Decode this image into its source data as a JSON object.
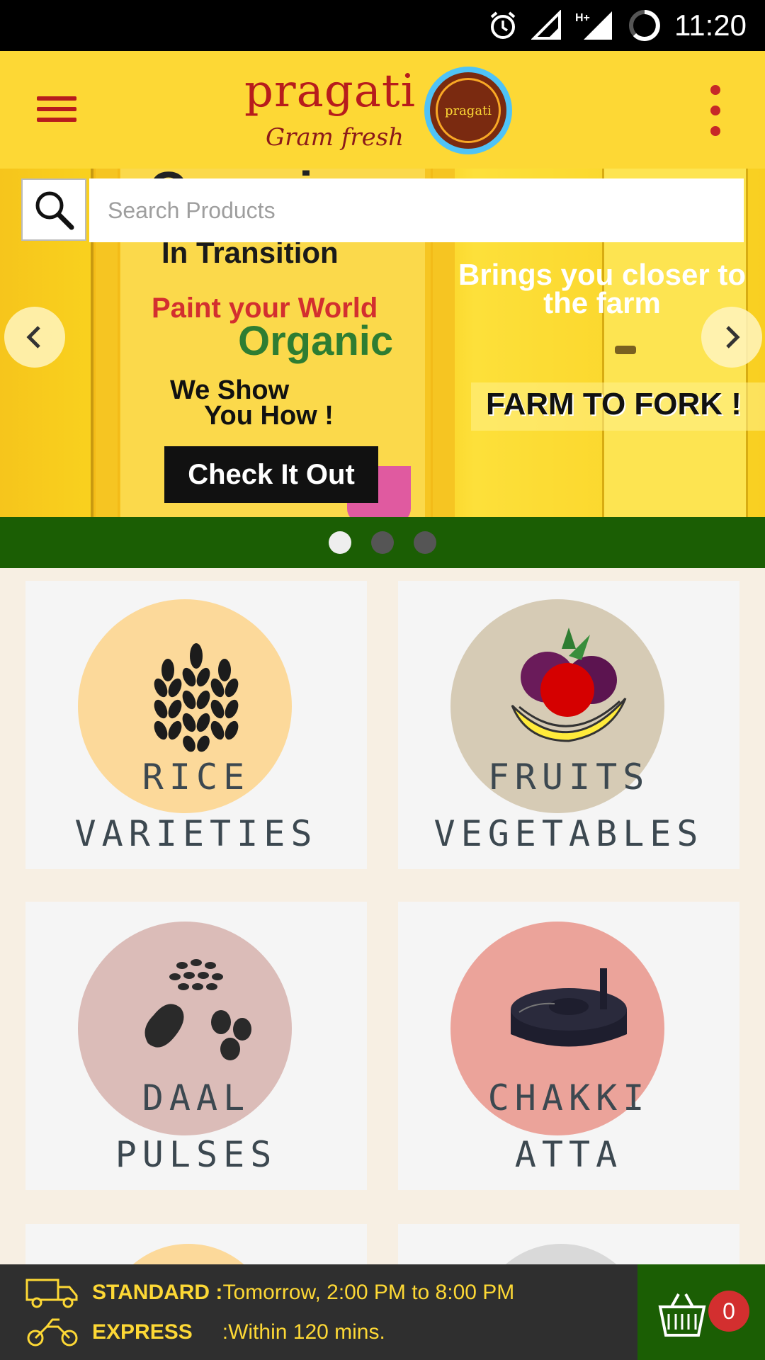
{
  "status_bar": {
    "time": "11:20",
    "icons": [
      "alarm-icon",
      "signal-roaming-icon",
      "signal-hplus-icon",
      "battery-icon"
    ]
  },
  "app_bar": {
    "logo_title": "pragati",
    "logo_subtitle": "Gram fresh",
    "logo_seal_text": "pragati",
    "brand_color": "#fdd835",
    "accent_color": "#b71c1c"
  },
  "search": {
    "placeholder": "Search Products"
  },
  "banner": {
    "heading": "Organic",
    "line_in_transition": "In Transition",
    "line_paint": "Paint your World",
    "line_organic": "Organic",
    "line_we_show": "We Show",
    "line_you_how": "You How !",
    "cta": "Check It Out",
    "tagline": "Brings you closer to the farm",
    "slogan": "FARM TO FORK !",
    "slides_count": 3,
    "active_slide": 1
  },
  "categories": [
    {
      "top": "RICE",
      "bottom": "VARIETIES",
      "circle_color": "#fcd99a",
      "icon": "wheat-icon"
    },
    {
      "top": "FRUITS",
      "bottom": "VEGETABLES",
      "circle_color": "#d6cbb5",
      "icon": "fruit-basket-icon"
    },
    {
      "top": "DAAL",
      "bottom": "PULSES",
      "circle_color": "#dbbcb8",
      "icon": "beans-icon"
    },
    {
      "top": "CHAKKI",
      "bottom": "ATTA",
      "circle_color": "#eba39a",
      "icon": "grinder-icon"
    }
  ],
  "delivery": {
    "standard_label": "STANDARD :",
    "standard_value": "Tomorrow, 2:00 PM to 8:00 PM",
    "express_label": "EXPRESS",
    "express_value": ":Within 120 mins."
  },
  "cart": {
    "count": "0"
  }
}
